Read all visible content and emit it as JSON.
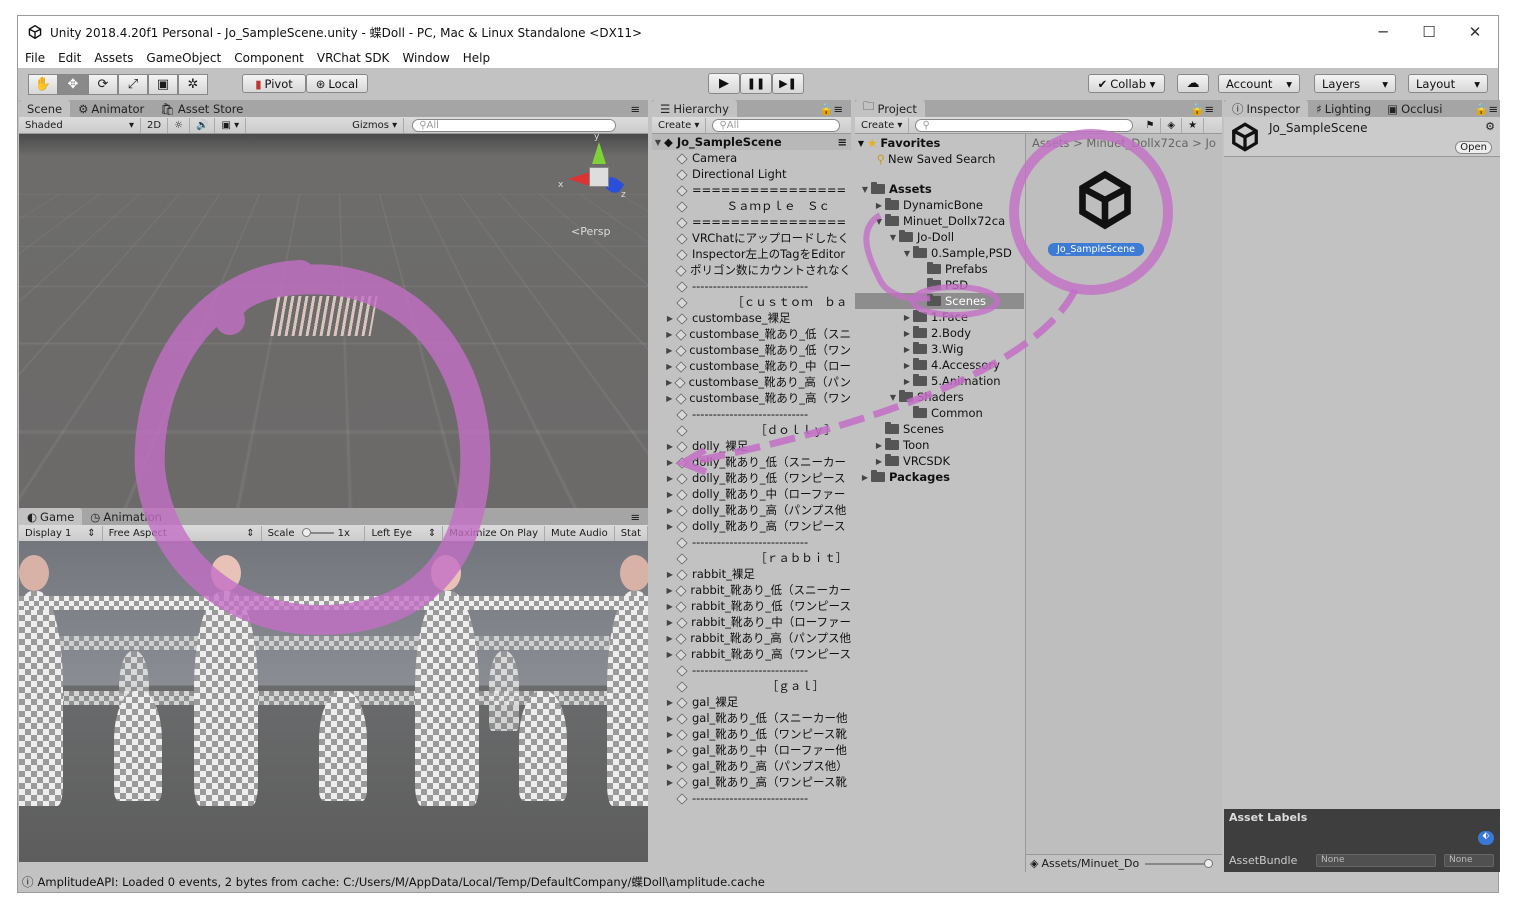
{
  "window": {
    "title": "Unity 2018.4.20f1 Personal - Jo_SampleScene.unity - 蝶Doll - PC, Mac & Linux Standalone <DX11>",
    "controls": [
      "─",
      "☐",
      "✕"
    ]
  },
  "menu": [
    "File",
    "Edit",
    "Assets",
    "GameObject",
    "Component",
    "VRChat SDK",
    "Window",
    "Help"
  ],
  "toolbar": {
    "tools": [
      "✋",
      "✥",
      "⟳",
      "⤢",
      "▣",
      "✲"
    ],
    "pivot": "Pivot",
    "local": "Local",
    "play": "▶",
    "pause": "❚❚",
    "step": "▶❚",
    "collab": "Collab ▾",
    "cloud": "☁",
    "account": "Account",
    "layers": "Layers",
    "layout": "Layout"
  },
  "scene": {
    "tabs": [
      "Scene",
      "Animator",
      "Asset Store"
    ],
    "shading": "Shaded",
    "mode2d": "2D",
    "gizmos": "Gizmos",
    "search_placeholder": "All",
    "persp": "Persp",
    "axes": {
      "x": "x",
      "y": "y",
      "z": "z"
    }
  },
  "game": {
    "tabs": [
      "Game",
      "Animation"
    ],
    "display": "Display 1",
    "aspect": "Free Aspect",
    "scale_label": "Scale",
    "scale_value": "1x",
    "eye": "Left Eye",
    "maximize": "Maximize On Play",
    "mute": "Mute Audio",
    "stats": "Stat"
  },
  "hierarchy": {
    "tab": "Hierarchy",
    "create": "Create",
    "search_placeholder": "All",
    "scene_name": "Jo_SampleScene",
    "items": [
      {
        "label": "Camera",
        "arrow": ""
      },
      {
        "label": "Directional Light",
        "arrow": ""
      },
      {
        "label": "================",
        "arrow": ""
      },
      {
        "label": "　　　Ｓａｍｐｌｅ　Ｓｃ",
        "arrow": ""
      },
      {
        "label": "================",
        "arrow": ""
      },
      {
        "label": "VRChatにアップロードしたく",
        "arrow": ""
      },
      {
        "label": "Inspector左上のTagをEditor",
        "arrow": ""
      },
      {
        "label": "ポリゴン数にカウントされなく",
        "arrow": ""
      },
      {
        "label": "----------------------------",
        "arrow": ""
      },
      {
        "label": "　　　　［ｃｕｓｔｏｍ　ｂａ",
        "arrow": ""
      },
      {
        "label": "custombase_裸足",
        "arrow": "▶"
      },
      {
        "label": "custombase_靴あり_低（スニ",
        "arrow": "▶"
      },
      {
        "label": "custombase_靴あり_低（ワン",
        "arrow": "▶"
      },
      {
        "label": "custombase_靴あり_中（ロー",
        "arrow": "▶"
      },
      {
        "label": "custombase_靴あり_高（パン",
        "arrow": "▶"
      },
      {
        "label": "custombase_靴あり_高（ワン",
        "arrow": "▶"
      },
      {
        "label": "----------------------------",
        "arrow": ""
      },
      {
        "label": "　　　　　　［ｄｏｌｌｙ］",
        "arrow": ""
      },
      {
        "label": "dolly_裸足",
        "arrow": "▶"
      },
      {
        "label": "dolly_靴あり_低（スニーカー",
        "arrow": "▶"
      },
      {
        "label": "dolly_靴あり_低（ワンピース",
        "arrow": "▶"
      },
      {
        "label": "dolly_靴あり_中（ローファー",
        "arrow": "▶"
      },
      {
        "label": "dolly_靴あり_高（パンプス他",
        "arrow": "▶"
      },
      {
        "label": "dolly_靴あり_高（ワンピース",
        "arrow": "▶"
      },
      {
        "label": "----------------------------",
        "arrow": ""
      },
      {
        "label": "　　　　　　［ｒａｂｂｉｔ］",
        "arrow": ""
      },
      {
        "label": "rabbit_裸足",
        "arrow": "▶"
      },
      {
        "label": "rabbit_靴あり_低（スニーカー",
        "arrow": "▶"
      },
      {
        "label": "rabbit_靴あり_低（ワンピース",
        "arrow": "▶"
      },
      {
        "label": "rabbit_靴あり_中（ローファー",
        "arrow": "▶"
      },
      {
        "label": "rabbit_靴あり_高（パンプス他",
        "arrow": "▶"
      },
      {
        "label": "rabbit_靴あり_高（ワンピース",
        "arrow": "▶"
      },
      {
        "label": "----------------------------",
        "arrow": ""
      },
      {
        "label": "　　　　　　　［ｇａｌ］",
        "arrow": ""
      },
      {
        "label": "gal_裸足",
        "arrow": "▶"
      },
      {
        "label": "gal_靴あり_低（スニーカー他",
        "arrow": "▶"
      },
      {
        "label": "gal_靴あり_低（ワンピース靴",
        "arrow": "▶"
      },
      {
        "label": "gal_靴あり_中（ローファー他",
        "arrow": "▶"
      },
      {
        "label": "gal_靴あり_高（パンプス他）",
        "arrow": "▶"
      },
      {
        "label": "gal_靴あり_高（ワンピース靴",
        "arrow": "▶"
      },
      {
        "label": "----------------------------",
        "arrow": ""
      }
    ]
  },
  "project": {
    "tab": "Project",
    "create": "Create",
    "breadcrumb": [
      "Assets",
      "Minuet_Dollx72ca",
      "Jo"
    ],
    "favorites_label": "Favorites",
    "favorites": [
      "New Saved Search"
    ],
    "tree": [
      {
        "label": "Assets",
        "depth": 0,
        "arrow": "▼",
        "bold": true
      },
      {
        "label": "DynamicBone",
        "depth": 1,
        "arrow": "▶"
      },
      {
        "label": "Minuet_Dollx72ca",
        "depth": 1,
        "arrow": "▼"
      },
      {
        "label": "Jo-Doll",
        "depth": 2,
        "arrow": "▼"
      },
      {
        "label": "0.Sample,PSD",
        "depth": 3,
        "arrow": "▼"
      },
      {
        "label": "Prefabs",
        "depth": 4,
        "arrow": ""
      },
      {
        "label": "PSD",
        "depth": 4,
        "arrow": ""
      },
      {
        "label": "Scenes",
        "depth": 4,
        "arrow": "",
        "selected": true
      },
      {
        "label": "1.Face",
        "depth": 3,
        "arrow": "▶"
      },
      {
        "label": "2.Body",
        "depth": 3,
        "arrow": "▶"
      },
      {
        "label": "3.Wig",
        "depth": 3,
        "arrow": "▶"
      },
      {
        "label": "4.Accessory",
        "depth": 3,
        "arrow": "▶"
      },
      {
        "label": "5.Animation",
        "depth": 3,
        "arrow": "▶"
      },
      {
        "label": "Shaders",
        "depth": 2,
        "arrow": "▼"
      },
      {
        "label": "Common",
        "depth": 3,
        "arrow": ""
      },
      {
        "label": "Scenes",
        "depth": 1,
        "arrow": ""
      },
      {
        "label": "Toon",
        "depth": 1,
        "arrow": "▶"
      },
      {
        "label": "VRCSDK",
        "depth": 1,
        "arrow": "▶"
      },
      {
        "label": "Packages",
        "depth": 0,
        "arrow": "▶",
        "bold": true
      }
    ],
    "asset_name": "Jo_SampleScene",
    "footer_path": "Assets/Minuet_Do"
  },
  "inspector": {
    "tabs": [
      "Inspector",
      "Lighting",
      "Occlusi"
    ],
    "object_name": "Jo_SampleScene",
    "open_button": "Open",
    "asset_labels": "Asset Labels",
    "asset_bundle": "AssetBundle",
    "bundle_value": "None",
    "variant_value": "None"
  },
  "status": {
    "message": "AmplitudeAPI: Loaded 0 events, 2 bytes from cache: C:/Users/M/AppData/Local/Temp/DefaultCompany/蝶Doll\\amplitude.cache"
  },
  "colors": {
    "editor_bg": "#c2c2c2",
    "annotation": "#c36fc6",
    "selected": "#8d8d8d"
  }
}
